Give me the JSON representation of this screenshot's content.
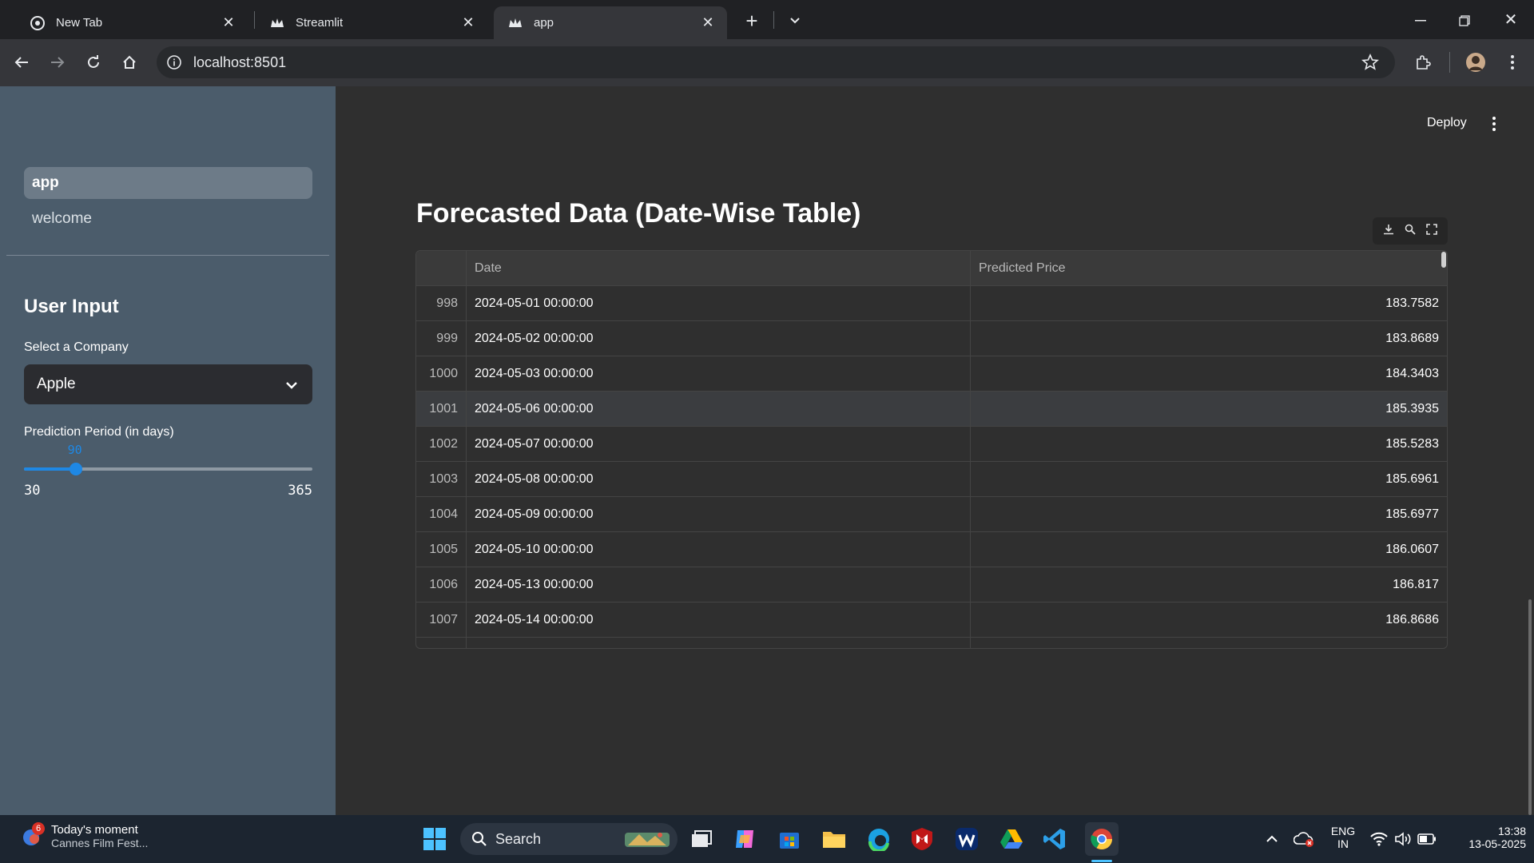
{
  "browser": {
    "tabs": [
      {
        "label": "New Tab",
        "icon": "chrome-icon"
      },
      {
        "label": "Streamlit",
        "icon": "streamlit-crown-icon"
      },
      {
        "label": "app",
        "icon": "streamlit-crown-icon",
        "active": true
      }
    ],
    "url": "localhost:8501"
  },
  "sidebar": {
    "nav": [
      {
        "label": "app",
        "active": true
      },
      {
        "label": "welcome",
        "active": false
      }
    ],
    "section_title": "User Input",
    "select": {
      "label": "Select a Company",
      "value": "Apple"
    },
    "slider": {
      "label": "Prediction Period (in days)",
      "value": "90",
      "min": "30",
      "max": "365",
      "fraction": 0.179
    }
  },
  "header": {
    "deploy_label": "Deploy"
  },
  "main": {
    "heading": "Forecasted Data (Date-Wise Table)",
    "table": {
      "columns": [
        "",
        "Date",
        "Predicted Price"
      ],
      "rows": [
        {
          "index": "998",
          "date": "2024-05-01 00:00:00",
          "price": "183.7582"
        },
        {
          "index": "999",
          "date": "2024-05-02 00:00:00",
          "price": "183.8689"
        },
        {
          "index": "1000",
          "date": "2024-05-03 00:00:00",
          "price": "184.3403"
        },
        {
          "index": "1001",
          "date": "2024-05-06 00:00:00",
          "price": "185.3935"
        },
        {
          "index": "1002",
          "date": "2024-05-07 00:00:00",
          "price": "185.5283"
        },
        {
          "index": "1003",
          "date": "2024-05-08 00:00:00",
          "price": "185.6961"
        },
        {
          "index": "1004",
          "date": "2024-05-09 00:00:00",
          "price": "185.6977"
        },
        {
          "index": "1005",
          "date": "2024-05-10 00:00:00",
          "price": "186.0607"
        },
        {
          "index": "1006",
          "date": "2024-05-13 00:00:00",
          "price": "186.817"
        },
        {
          "index": "1007",
          "date": "2024-05-14 00:00:00",
          "price": "186.8686"
        }
      ]
    }
  },
  "taskbar": {
    "weather": {
      "title": "Today's moment",
      "subtitle": "Cannes Film Fest...",
      "badge": "6"
    },
    "search_label": "Search",
    "lang": {
      "line1": "ENG",
      "line2": "IN"
    },
    "time": "13:38",
    "date": "13-05-2025"
  },
  "colors": {
    "accent": "#1e88e5",
    "sidebar": "#4b5c6b",
    "main_bg": "#2f2f2f"
  }
}
